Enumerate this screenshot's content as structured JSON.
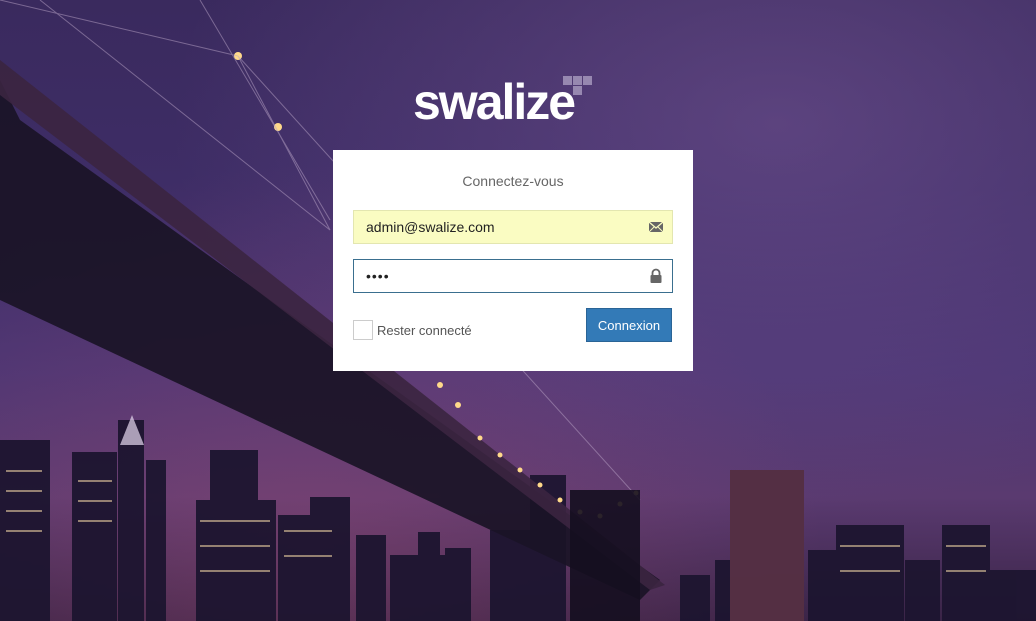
{
  "brand": {
    "logo_text": "swalize"
  },
  "login": {
    "title": "Connectez-vous",
    "email_value": "admin@swalize.com",
    "password_value": "••••",
    "remember_label": "Rester connecté",
    "remember_checked": false,
    "submit_label": "Connexion"
  },
  "icons": {
    "email": "envelope-icon",
    "password": "lock-icon"
  },
  "colors": {
    "primary_button": "#337ab7",
    "email_autofill_bg": "#fafcc2",
    "focus_border": "#3a6f8f"
  }
}
